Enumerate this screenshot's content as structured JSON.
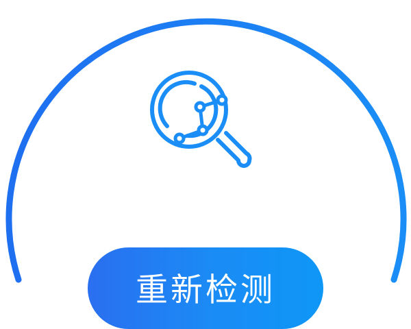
{
  "gauge": {
    "colors": {
      "arc_start": "#1f6ff1",
      "arc_end": "#1a8ef6",
      "icon": "#1a8ef6"
    }
  },
  "icon": {
    "name": "magnifier-network-scan-icon"
  },
  "actions": {
    "recheck_label": "重新检测"
  }
}
